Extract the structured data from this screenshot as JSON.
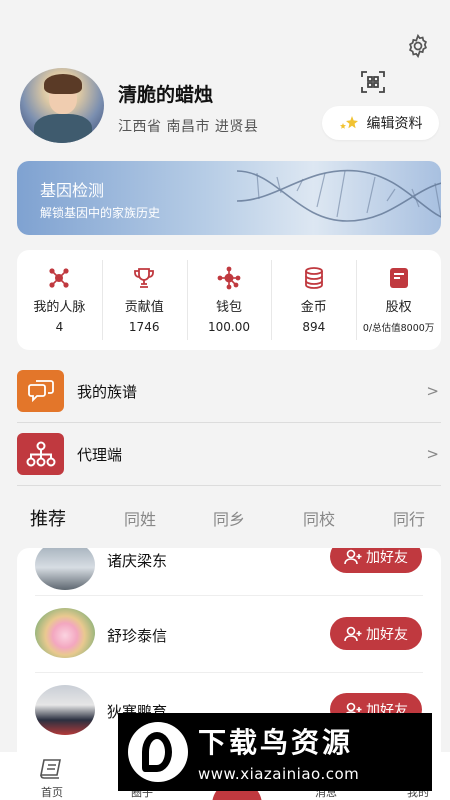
{
  "header": {
    "settings_icon": "gear-icon",
    "scan_icon": "qr-scan-icon"
  },
  "profile": {
    "name": "清脆的蜡烛",
    "region": "江西省 南昌市 进贤县",
    "edit_label": "编辑资料"
  },
  "gene_banner": {
    "title": "基因检测",
    "subtitle": "解锁基因中的家族历史"
  },
  "stats": [
    {
      "label": "我的人脉",
      "value": "4",
      "icon": "network-icon"
    },
    {
      "label": "贡献值",
      "value": "1746",
      "icon": "trophy-icon"
    },
    {
      "label": "钱包",
      "value": "100.00",
      "icon": "wallet-icon"
    },
    {
      "label": "金币",
      "value": "894",
      "icon": "coins-icon"
    },
    {
      "label": "股权",
      "value": "0/总估值8000万",
      "icon": "equity-icon"
    }
  ],
  "menu": [
    {
      "label": "我的族谱",
      "chevron": ">"
    },
    {
      "label": "代理端",
      "chevron": ">"
    }
  ],
  "tabs": [
    "推荐",
    "同姓",
    "同乡",
    "同校",
    "同行"
  ],
  "people": [
    {
      "name": "诸庆梁东",
      "action": "加好友"
    },
    {
      "name": "舒珍泰信",
      "action": "加好友"
    },
    {
      "name": "狄寒鹏育",
      "action": "加好友"
    }
  ],
  "tabbar": [
    {
      "label": "首页",
      "icon": "book-icon"
    },
    {
      "label": "圈子",
      "icon": "circle-icon"
    },
    {
      "label": "消息",
      "icon": "message-icon"
    },
    {
      "label": "我的",
      "icon": "user-icon"
    }
  ],
  "watermark": {
    "title": "下载鸟资源",
    "url": "www.xiazainiao.com"
  },
  "colors": {
    "accent": "#c0393f",
    "orange": "#e3762a",
    "background": "#f3f3f3"
  }
}
